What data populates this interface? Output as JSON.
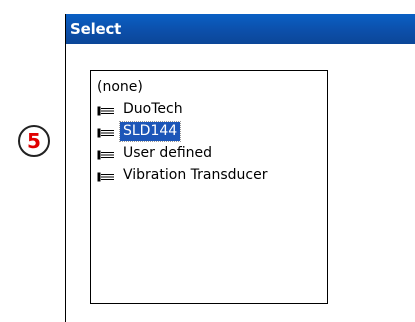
{
  "step_marker": "5",
  "dialog": {
    "title": "Select",
    "list": {
      "selected_index": 2,
      "items": [
        {
          "label": "(none)",
          "icon": null
        },
        {
          "label": "DuoTech",
          "icon": "probe-icon"
        },
        {
          "label": "SLD144",
          "icon": "probe-icon"
        },
        {
          "label": "User defined",
          "icon": "probe-icon"
        },
        {
          "label": "Vibration Transducer",
          "icon": "probe-icon"
        }
      ]
    }
  },
  "colors": {
    "titlebar": "#0c4ea8",
    "selection": "#1c56b8",
    "step_number": "#e00000"
  }
}
